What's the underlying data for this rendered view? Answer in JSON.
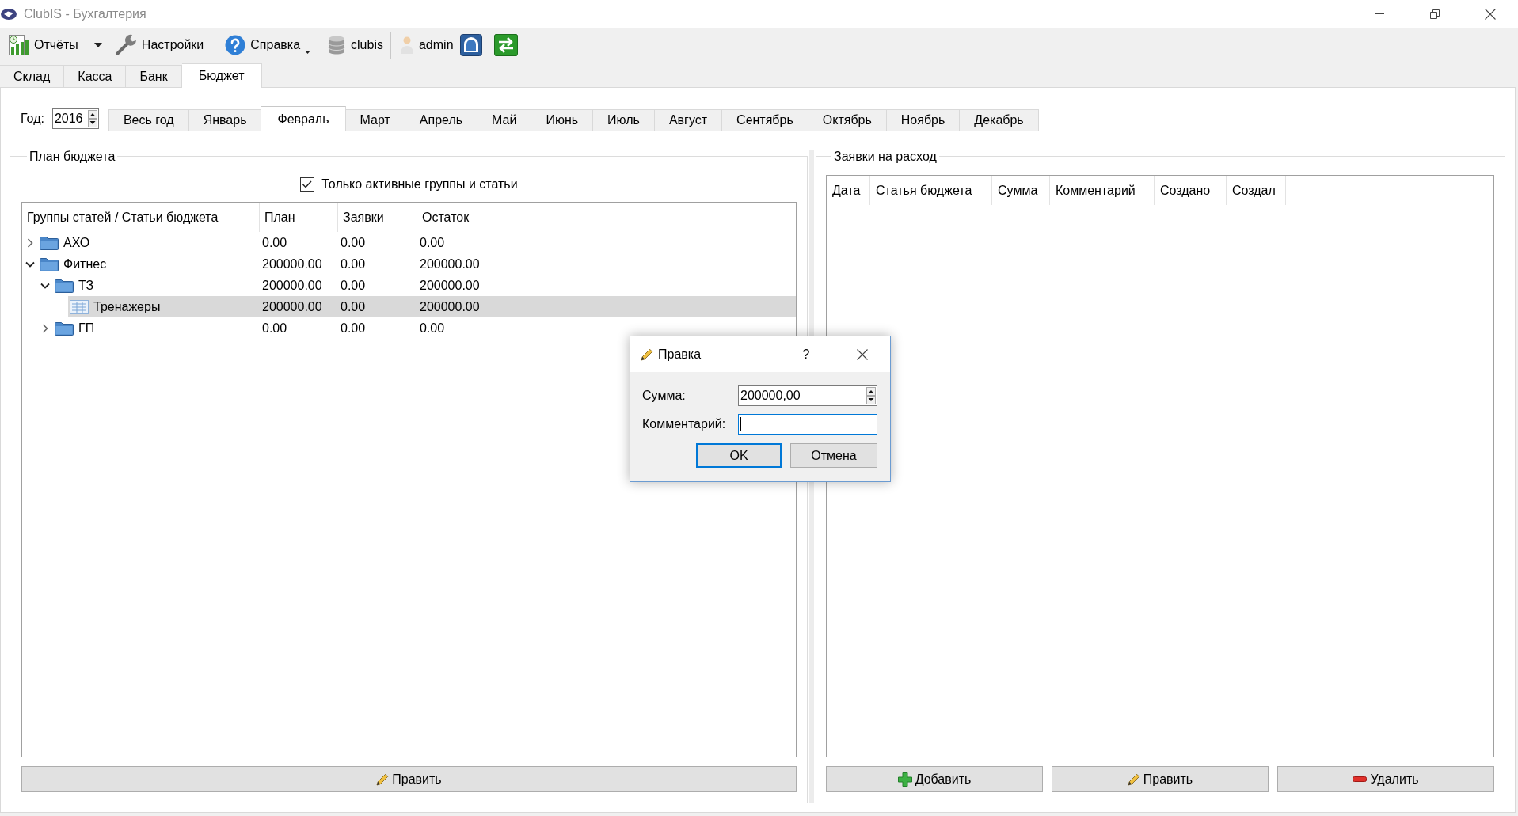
{
  "window": {
    "title": "ClubIS - Бухгалтерия"
  },
  "toolbar": {
    "items": [
      {
        "kind": "menu",
        "label": "Отчёты"
      },
      {
        "kind": "button",
        "label": "Настройки"
      },
      {
        "kind": "popup",
        "label": "Справка"
      },
      {
        "kind": "label",
        "label": "clubis"
      },
      {
        "kind": "label",
        "label": "admin"
      }
    ]
  },
  "main_tabs": [
    {
      "label": "Склад",
      "selected": false
    },
    {
      "label": "Касса",
      "selected": false
    },
    {
      "label": "Банк",
      "selected": false
    },
    {
      "label": "Бюджет",
      "selected": true
    }
  ],
  "period": {
    "year_label": "Год:",
    "year": "2016",
    "months": [
      {
        "label": "Весь год",
        "selected": false
      },
      {
        "label": "Январь",
        "selected": false
      },
      {
        "label": "Февраль",
        "selected": true
      },
      {
        "label": "Март",
        "selected": false
      },
      {
        "label": "Апрель",
        "selected": false
      },
      {
        "label": "Май",
        "selected": false
      },
      {
        "label": "Июнь",
        "selected": false
      },
      {
        "label": "Июль",
        "selected": false
      },
      {
        "label": "Август",
        "selected": false
      },
      {
        "label": "Сентябрь",
        "selected": false
      },
      {
        "label": "Октябрь",
        "selected": false
      },
      {
        "label": "Ноябрь",
        "selected": false
      },
      {
        "label": "Декабрь",
        "selected": false
      }
    ]
  },
  "budget_plan": {
    "title": "План бюджета",
    "filter": {
      "label": "Только активные группы и статьи",
      "checked": true
    },
    "tree": {
      "columns": [
        "Группы статей / Статьи бюджета",
        "План",
        "Заявки",
        "Остаток"
      ],
      "rows": [
        {
          "kind": "folder",
          "name": "АХО",
          "values": [
            "0.00",
            "0.00",
            "0.00"
          ],
          "expanded": false,
          "selected": false
        },
        {
          "kind": "folder",
          "name": "Фитнес",
          "values": [
            "200000.00",
            "0.00",
            "200000.00"
          ],
          "expanded": true,
          "selected": false,
          "children": [
            {
              "kind": "folder",
              "name": "ТЗ",
              "values": [
                "200000.00",
                "0.00",
                "200000.00"
              ],
              "expanded": true,
              "selected": false,
              "children": [
                {
                  "kind": "item",
                  "name": "Тренажеры",
                  "values": [
                    "200000.00",
                    "0.00",
                    "200000.00"
                  ],
                  "selected": true
                }
              ]
            },
            {
              "kind": "folder",
              "name": "ГП",
              "values": [
                "0.00",
                "0.00",
                "0.00"
              ],
              "expanded": false,
              "selected": false
            }
          ]
        }
      ]
    },
    "button": {
      "kind": "edit",
      "label": "Править"
    }
  },
  "requests": {
    "title": "Заявки на расход",
    "table": {
      "columns": [
        "Дата",
        "Статья бюджета",
        "Сумма",
        "Комментарий",
        "Создано",
        "Создал"
      ]
    },
    "buttons": [
      {
        "kind": "add",
        "label": "Добавить"
      },
      {
        "kind": "edit",
        "label": "Править"
      },
      {
        "kind": "delete",
        "label": "Удалить"
      }
    ]
  },
  "dialog": {
    "title": "Правка",
    "help_label": "?",
    "fields": [
      {
        "kind": "spin",
        "label": "Сумма:",
        "value": "200000,00",
        "focused": false
      },
      {
        "kind": "text",
        "label": "Комментарий:",
        "focused": true
      }
    ],
    "buttons": [
      {
        "label": "OK",
        "default": true
      },
      {
        "label": "Отмена",
        "default": false
      }
    ]
  }
}
